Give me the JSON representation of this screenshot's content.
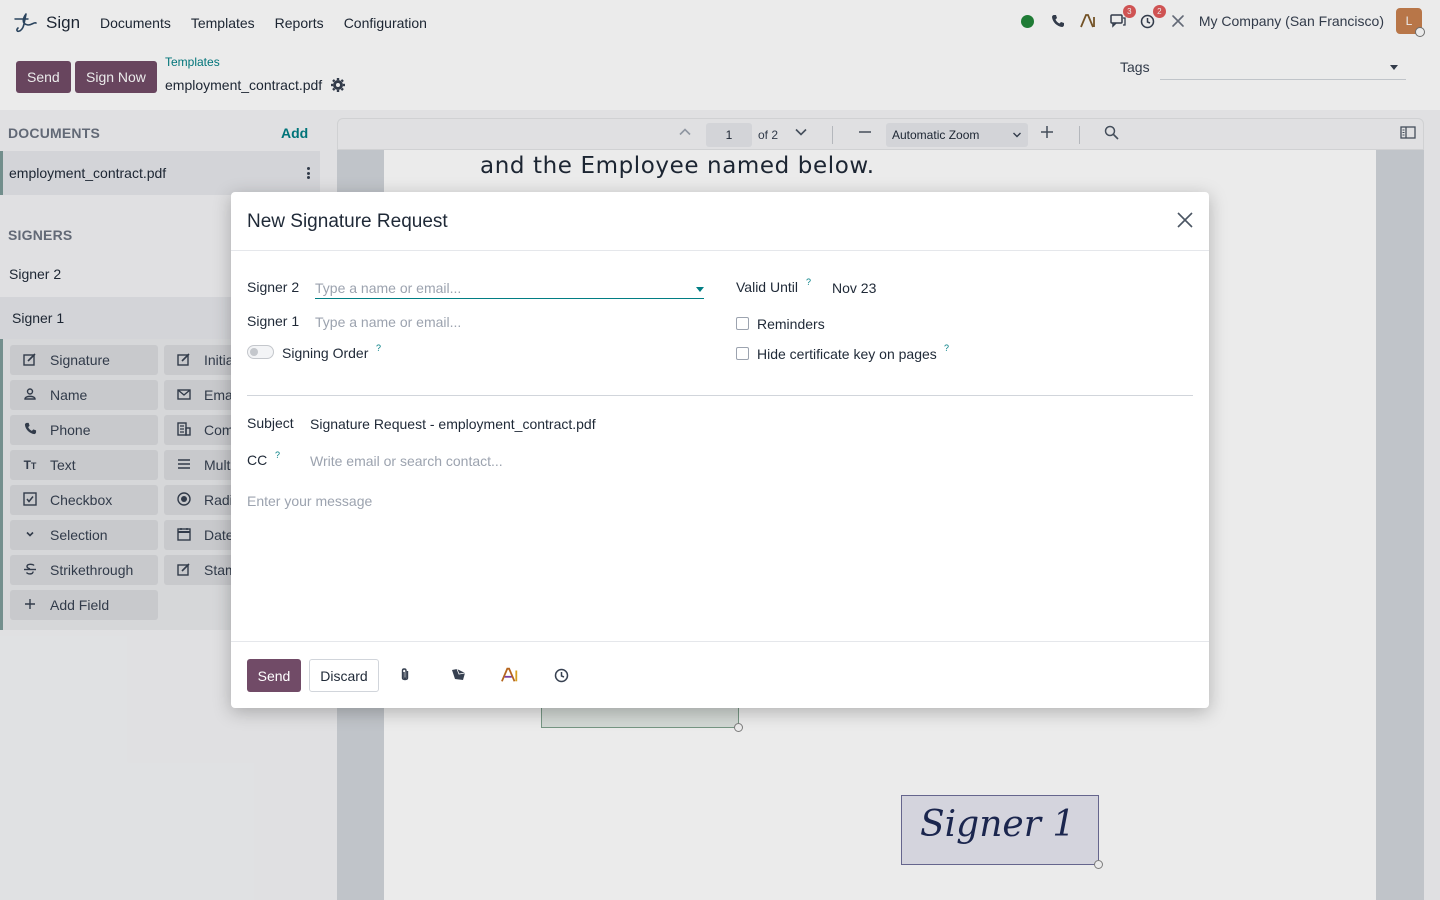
{
  "app": {
    "name": "Sign",
    "menu": [
      "Documents",
      "Templates",
      "Reports",
      "Configuration"
    ],
    "company": "My Company (San Francisco)",
    "avatar_initial": "L",
    "badges": {
      "messages": "3",
      "activities": "2"
    },
    "icons": [
      "presence-dot-icon",
      "phone-icon",
      "ai-icon",
      "chat-icon",
      "clock-icon",
      "tools-icon"
    ]
  },
  "control": {
    "send_label": "Send",
    "sign_now_label": "Sign Now",
    "breadcrumb_parent": "Templates",
    "breadcrumb_current": "employment_contract.pdf",
    "tags_label": "Tags"
  },
  "sidebar": {
    "documents_title": "DOCUMENTS",
    "add_label": "Add",
    "document_name": "employment_contract.pdf",
    "signers_title": "SIGNERS",
    "signers": [
      "Signer 2",
      "Signer 1"
    ],
    "fields": [
      {
        "label": "Signature",
        "icon": "signature-icon"
      },
      {
        "label": "Initia",
        "icon": "initials-icon"
      },
      {
        "label": "Name",
        "icon": "user-icon"
      },
      {
        "label": "Ema",
        "icon": "email-icon"
      },
      {
        "label": "Phone",
        "icon": "phone-icon"
      },
      {
        "label": "Com",
        "icon": "company-icon"
      },
      {
        "label": "Text",
        "icon": "text-icon"
      },
      {
        "label": "Multi",
        "icon": "multiline-icon"
      },
      {
        "label": "Checkbox",
        "icon": "checkbox-icon"
      },
      {
        "label": "Radi",
        "icon": "radio-icon"
      },
      {
        "label": "Selection",
        "icon": "chevron-down-icon"
      },
      {
        "label": "Date",
        "icon": "calendar-icon"
      },
      {
        "label": "Strikethrough",
        "icon": "strikethrough-icon"
      },
      {
        "label": "Stam",
        "icon": "stamp-icon"
      },
      {
        "label": "Add Field",
        "icon": "plus-icon"
      }
    ]
  },
  "pdf": {
    "page": "1",
    "page_of": "of 2",
    "zoom": "Automatic Zoom",
    "visible_text": "and the Employee named below.",
    "signature_box_text": "Signer 1"
  },
  "modal": {
    "title": "New Signature Request",
    "signer2_label": "Signer 2",
    "signer2_placeholder": "Type a name or email...",
    "signer1_label": "Signer 1",
    "signer1_placeholder": "Type a name or email...",
    "signing_order_label": "Signing Order",
    "valid_until_label": "Valid Until",
    "valid_until_value": "Nov 23",
    "reminders_label": "Reminders",
    "hide_cert_label": "Hide certificate key on pages",
    "subject_label": "Subject",
    "subject_value": "Signature Request - employment_contract.pdf",
    "cc_label": "CC",
    "cc_placeholder": "Write email or search contact...",
    "message_placeholder": "Enter your message",
    "tooltip_mark": "?",
    "send_label": "Send",
    "discard_label": "Discard"
  },
  "colors": {
    "brand": "#714b67",
    "accent": "#017e84",
    "badge": "#e15b5b",
    "presence": "#22863a"
  }
}
